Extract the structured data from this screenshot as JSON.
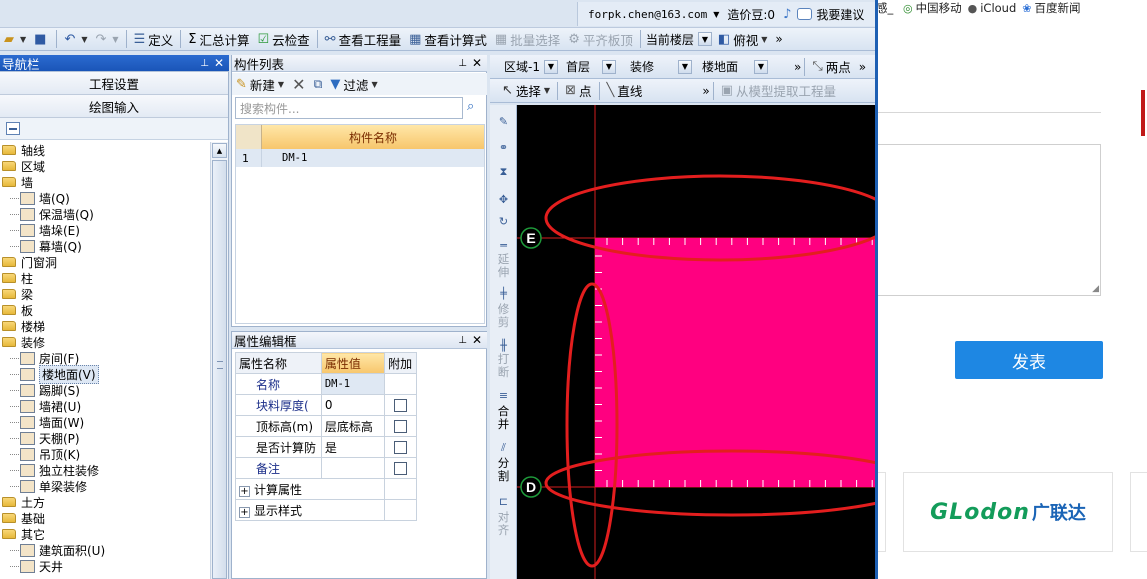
{
  "title_bar": {
    "account_email": "forpk.chen@163.com",
    "bean_label": "造价豆:0",
    "feedback_label": "我要建议"
  },
  "main_toolbar": {
    "define": "定义",
    "sum_calc": "汇总计算",
    "cloud_check": "云检查",
    "view_quantity": "查看工程量",
    "view_formula": "查看计算式",
    "batch_select": "批量选择",
    "align_slab_top": "平齐板顶",
    "current_floor": "当前楼层",
    "view_mode": "俯视"
  },
  "navigator": {
    "title": "导航栏",
    "project_settings": "工程设置",
    "drawing_input": "绘图输入",
    "tree": [
      {
        "label": "轴线",
        "level": 0
      },
      {
        "label": "区域",
        "level": 0
      },
      {
        "label": "墙",
        "level": 0
      },
      {
        "label": "墙(Q)",
        "level": 1,
        "icon": "wall-icon"
      },
      {
        "label": "保温墙(Q)",
        "level": 1,
        "icon": "insulation-wall-icon"
      },
      {
        "label": "墙垛(E)",
        "level": 1,
        "icon": "wall-pier-icon"
      },
      {
        "label": "幕墙(Q)",
        "level": 1,
        "icon": "curtain-wall-icon"
      },
      {
        "label": "门窗洞",
        "level": 0
      },
      {
        "label": "柱",
        "level": 0
      },
      {
        "label": "梁",
        "level": 0
      },
      {
        "label": "板",
        "level": 0
      },
      {
        "label": "楼梯",
        "level": 0
      },
      {
        "label": "装修",
        "level": 0
      },
      {
        "label": "房间(F)",
        "level": 1,
        "icon": "room-icon"
      },
      {
        "label": "楼地面(V)",
        "level": 1,
        "icon": "floor-surface-icon",
        "selected": true
      },
      {
        "label": "踢脚(S)",
        "level": 1,
        "icon": "skirting-icon"
      },
      {
        "label": "墙裙(U)",
        "level": 1,
        "icon": "dado-icon"
      },
      {
        "label": "墙面(W)",
        "level": 1,
        "icon": "wall-surface-icon"
      },
      {
        "label": "天棚(P)",
        "level": 1,
        "icon": "ceiling-icon"
      },
      {
        "label": "吊顶(K)",
        "level": 1,
        "icon": "suspended-ceiling-icon"
      },
      {
        "label": "独立柱装修",
        "level": 1,
        "icon": "column-finish-icon"
      },
      {
        "label": "单梁装修",
        "level": 1,
        "icon": "beam-finish-icon"
      },
      {
        "label": "土方",
        "level": 0
      },
      {
        "label": "基础",
        "level": 0
      },
      {
        "label": "其它",
        "level": 0
      },
      {
        "label": "建筑面积(U)",
        "level": 1,
        "icon": "building-area-icon"
      },
      {
        "label": "天井",
        "level": 1,
        "icon": "courtyard-icon"
      }
    ]
  },
  "component_list": {
    "title": "构件列表",
    "new_label": "新建",
    "filter_label": "过滤",
    "search_placeholder": "搜索构件...",
    "column_header": "构件名称",
    "rows": [
      {
        "index": "1",
        "name": "DM-1"
      }
    ]
  },
  "property_editor": {
    "title": "属性编辑框",
    "headers": {
      "name": "属性名称",
      "value": "属性值",
      "extra": "附加"
    },
    "rows": [
      {
        "name": "名称",
        "value": "DM-1"
      },
      {
        "name": "块料厚度(",
        "value": "0"
      },
      {
        "name": "顶标高(m)",
        "value": "层底标高"
      },
      {
        "name": "是否计算防",
        "value": "是"
      },
      {
        "name": "备注",
        "value": ""
      }
    ],
    "groups": [
      "计算属性",
      "显示样式"
    ]
  },
  "drawing_toolbar": {
    "region": "区域-1",
    "floor": "首层",
    "category": "装修",
    "component_type": "楼地面",
    "two_points": "两点",
    "select": "选择",
    "point": "点",
    "line": "直线",
    "extract_quantity": "从模型提取工程量"
  },
  "side_tools": {
    "extend": "延伸",
    "trim": "修剪",
    "break": "打断",
    "merge": "合并",
    "split": "分割",
    "align": "对齐"
  },
  "canvas": {
    "axis_labels": [
      "E",
      "D"
    ],
    "floor_fill_color": "#ff0080",
    "annotation_color": "#e31e1e",
    "background_color": "#000000"
  },
  "browser": {
    "bookmark_fragment": "感_",
    "bookmarks": [
      "中国移动",
      "iCloud",
      "百度新闻"
    ],
    "publish_button": "发表",
    "ad_logo": "GLodon",
    "ad_logo_cn": "广联达"
  }
}
